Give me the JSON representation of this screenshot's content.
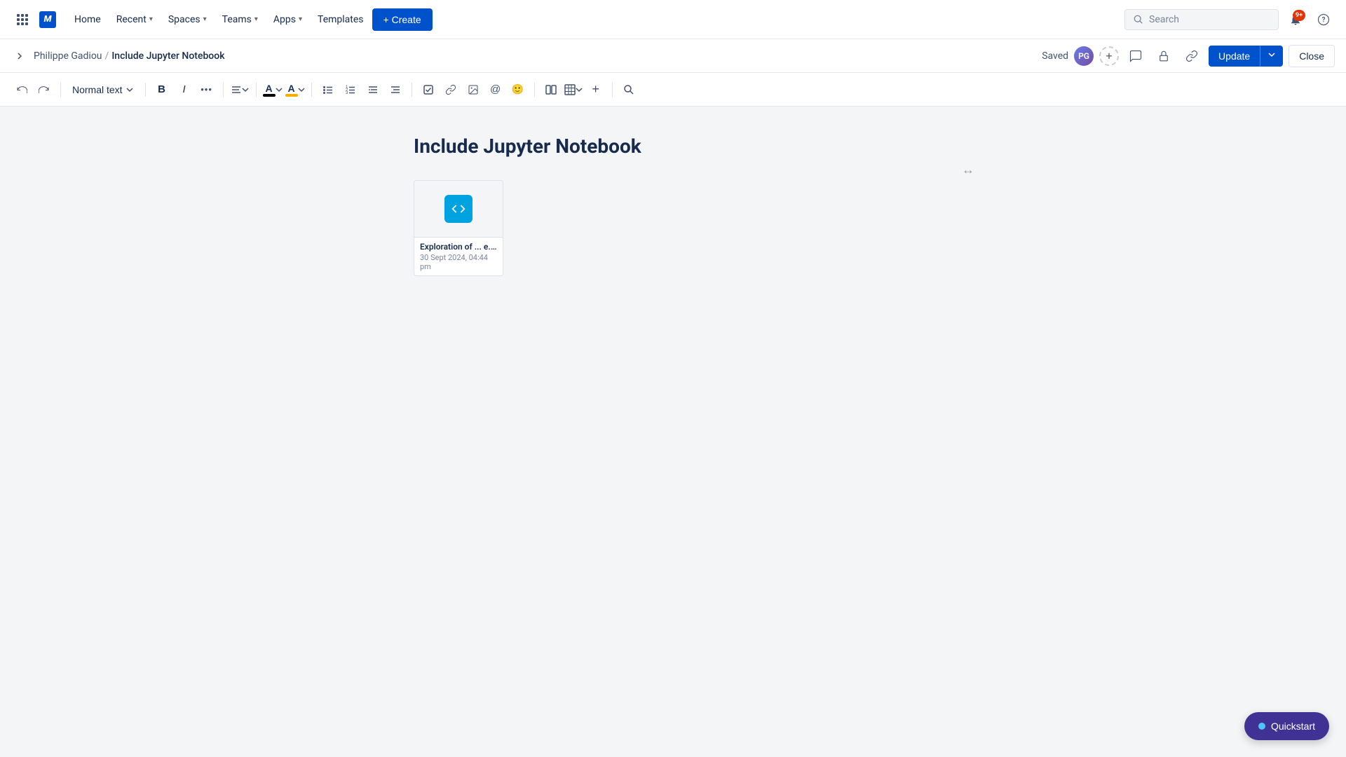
{
  "nav": {
    "home": "Home",
    "recent": "Recent",
    "spaces": "Spaces",
    "teams": "Teams",
    "apps": "Apps",
    "templates": "Templates",
    "create": "+ Create",
    "search_placeholder": "Search",
    "notification_count": "9+"
  },
  "breadcrumb": {
    "parent": "Philippe Gadiou",
    "separator": "/",
    "current": "Include Jupyter Notebook",
    "saved": "Saved"
  },
  "toolbar": {
    "text_style": "Normal text",
    "undo": "↩",
    "redo": "↪",
    "bold": "B",
    "italic": "I",
    "more": "•••",
    "align": "≡",
    "text_color": "A",
    "highlight_color": "A"
  },
  "page": {
    "title": "Include Jupyter Notebook",
    "resize_icon": "↔"
  },
  "notebook_card": {
    "name": "Exploration of ... e.ipynb",
    "date": "30 Sept 2024, 04:44 pm"
  },
  "buttons": {
    "update": "Update",
    "close": "Close",
    "quickstart": "Quickstart"
  }
}
